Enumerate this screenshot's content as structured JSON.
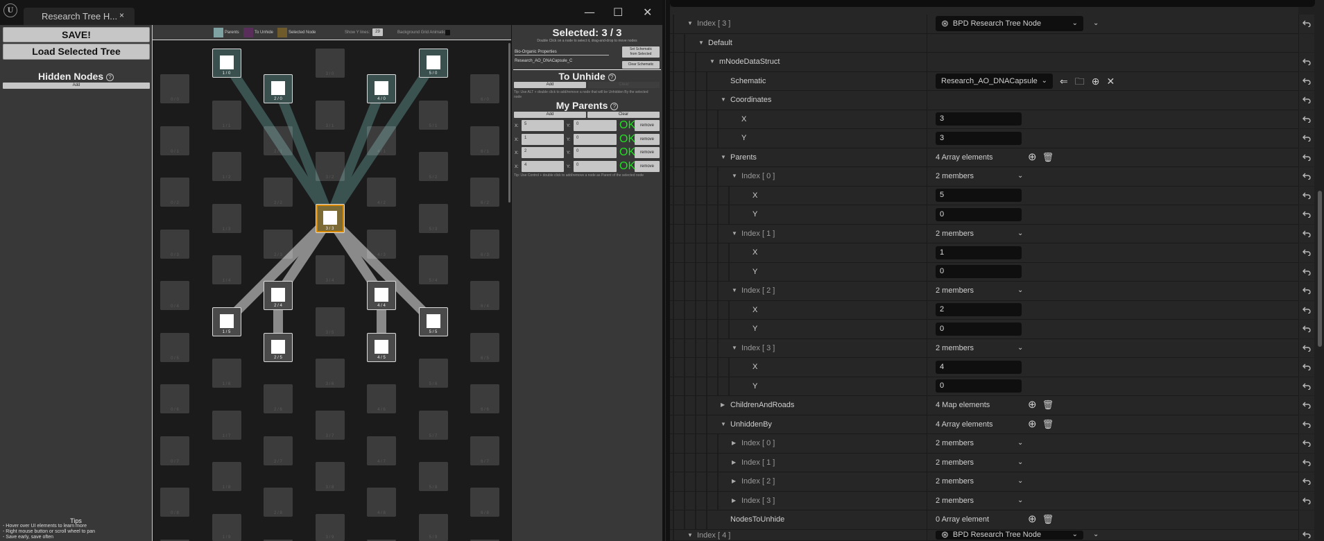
{
  "window": {
    "tab_title": "Research Tree H...",
    "close": "×",
    "minimize": "—",
    "maximize": "☐",
    "close_window": "✕",
    "logo": "U"
  },
  "left": {
    "save": "SAVE!",
    "load": "Load Selected Tree",
    "hidden_nodes_title": "Hidden Nodes",
    "help": "?",
    "add": "Add",
    "tips_title": "Tips",
    "tips": [
      "- Hover over UI elements to learn more",
      "- Right mouse button or scroll wheel to pan",
      "- Save early, save often"
    ]
  },
  "legend": {
    "parents": "Parents",
    "to_unhide": "To Unhide",
    "selected_node": "Selected Node",
    "show_y_lines_label": "Show Y lines:",
    "show_y_lines_value": "29",
    "bg_anim_label": "Background Grid Animation:"
  },
  "colors": {
    "parents": "#7fa3a3",
    "to_unhide": "#5a2e5a",
    "selected_node": "#6e5a2a",
    "parent_line": "#3a5250",
    "child_line": "#8a8a8a",
    "ok": "#22e022"
  },
  "graph": {
    "cols": 7,
    "rows": 10,
    "selected": [
      3,
      3
    ],
    "parents": [
      [
        1,
        0
      ],
      [
        2,
        0
      ],
      [
        4,
        0
      ],
      [
        5,
        0
      ]
    ],
    "children": [
      [
        2,
        4
      ],
      [
        4,
        4
      ],
      [
        1,
        5
      ],
      [
        5,
        5
      ],
      [
        2,
        5
      ],
      [
        4,
        5
      ]
    ],
    "parent_edges": [
      [
        [
          1,
          0
        ],
        [
          3,
          3
        ]
      ],
      [
        [
          2,
          0
        ],
        [
          3,
          3
        ]
      ],
      [
        [
          4,
          0
        ],
        [
          3,
          3
        ]
      ],
      [
        [
          5,
          0
        ],
        [
          3,
          3
        ]
      ]
    ],
    "child_edges": [
      [
        [
          3,
          3
        ],
        [
          2,
          4
        ]
      ],
      [
        [
          3,
          3
        ],
        [
          4,
          4
        ]
      ],
      [
        [
          3,
          3
        ],
        [
          1,
          5
        ]
      ],
      [
        [
          3,
          3
        ],
        [
          5,
          5
        ]
      ],
      [
        [
          2,
          4
        ],
        [
          2,
          5
        ]
      ],
      [
        [
          4,
          4
        ],
        [
          4,
          5
        ]
      ]
    ]
  },
  "selection": {
    "title": "Selected: 3 / 3",
    "hint": "Double Click on a node to select it, drag-and-drop to move nodes",
    "schematic_category": "Bio-Organic Properties",
    "schematic_name": "Research_AO_DNACapsule_C",
    "set_btn": "Set Schematic\nfrom Selected",
    "clear_btn": "Clear Schematic",
    "to_unhide_title": "To Unhide",
    "add": "Add",
    "clear": "Clear",
    "tip_unhide": "Tip: Use ALT + double click to add/remove a node that will be Unhidden By the selected node",
    "my_parents_title": "My Parents",
    "x_label": "X:",
    "y_label": "Y:",
    "parents": [
      {
        "x": "5",
        "y": "0",
        "status": "OK",
        "remove": "remove"
      },
      {
        "x": "1",
        "y": "0",
        "status": "OK",
        "remove": "remove"
      },
      {
        "x": "2",
        "y": "0",
        "status": "OK",
        "remove": "remove"
      },
      {
        "x": "4",
        "y": "0",
        "status": "OK",
        "remove": "remove"
      }
    ],
    "tip_parents": "Tip: Use Control + double click to add/remove a node as Parent of the selected node"
  },
  "details": {
    "rows": [
      {
        "label": "Index [ 3 ]",
        "depth": 0,
        "arrow": "down",
        "dim": true,
        "value": {
          "type": "class",
          "text": "BPD Research Tree Node"
        }
      },
      {
        "label": "Default",
        "depth": 1,
        "arrow": "down",
        "value": {
          "type": "none"
        },
        "noreset": true
      },
      {
        "label": "mNodeDataStruct",
        "depth": 2,
        "arrow": "down",
        "value": {
          "type": "none"
        }
      },
      {
        "label": "Schematic",
        "depth": 3,
        "value": {
          "type": "object",
          "text": "Research_AO_DNACapsule"
        }
      },
      {
        "label": "Coordinates",
        "depth": 3,
        "arrow": "down",
        "value": {
          "type": "none"
        }
      },
      {
        "label": "X",
        "depth": 4,
        "value": {
          "type": "num",
          "text": "3"
        }
      },
      {
        "label": "Y",
        "depth": 4,
        "value": {
          "type": "num",
          "text": "3"
        }
      },
      {
        "label": "Parents",
        "depth": 3,
        "arrow": "down",
        "value": {
          "type": "array",
          "text": "4 Array elements"
        }
      },
      {
        "label": "Index [ 0 ]",
        "depth": 4,
        "arrow": "down",
        "dim": true,
        "value": {
          "type": "members",
          "text": "2 members"
        }
      },
      {
        "label": "X",
        "depth": 5,
        "value": {
          "type": "num",
          "text": "5"
        }
      },
      {
        "label": "Y",
        "depth": 5,
        "value": {
          "type": "num",
          "text": "0"
        }
      },
      {
        "label": "Index [ 1 ]",
        "depth": 4,
        "arrow": "down",
        "dim": true,
        "value": {
          "type": "members",
          "text": "2 members"
        }
      },
      {
        "label": "X",
        "depth": 5,
        "value": {
          "type": "num",
          "text": "1"
        }
      },
      {
        "label": "Y",
        "depth": 5,
        "value": {
          "type": "num",
          "text": "0"
        }
      },
      {
        "label": "Index [ 2 ]",
        "depth": 4,
        "arrow": "down",
        "dim": true,
        "value": {
          "type": "members",
          "text": "2 members"
        }
      },
      {
        "label": "X",
        "depth": 5,
        "value": {
          "type": "num",
          "text": "2"
        }
      },
      {
        "label": "Y",
        "depth": 5,
        "value": {
          "type": "num",
          "text": "0"
        }
      },
      {
        "label": "Index [ 3 ]",
        "depth": 4,
        "arrow": "down",
        "dim": true,
        "value": {
          "type": "members",
          "text": "2 members"
        }
      },
      {
        "label": "X",
        "depth": 5,
        "value": {
          "type": "num",
          "text": "4"
        }
      },
      {
        "label": "Y",
        "depth": 5,
        "value": {
          "type": "num",
          "text": "0"
        }
      },
      {
        "label": "ChildrenAndRoads",
        "depth": 3,
        "arrow": "right",
        "value": {
          "type": "array",
          "text": "4 Map elements"
        }
      },
      {
        "label": "UnhiddenBy",
        "depth": 3,
        "arrow": "down",
        "value": {
          "type": "array",
          "text": "4 Array elements"
        }
      },
      {
        "label": "Index [ 0 ]",
        "depth": 4,
        "arrow": "right",
        "dim": true,
        "value": {
          "type": "members",
          "text": "2 members"
        }
      },
      {
        "label": "Index [ 1 ]",
        "depth": 4,
        "arrow": "right",
        "dim": true,
        "value": {
          "type": "members",
          "text": "2 members"
        }
      },
      {
        "label": "Index [ 2 ]",
        "depth": 4,
        "arrow": "right",
        "dim": true,
        "value": {
          "type": "members",
          "text": "2 members"
        }
      },
      {
        "label": "Index [ 3 ]",
        "depth": 4,
        "arrow": "right",
        "dim": true,
        "value": {
          "type": "members",
          "text": "2 members"
        }
      },
      {
        "label": "NodesToUnhide",
        "depth": 3,
        "value": {
          "type": "array",
          "text": "0 Array element"
        },
        "noreset": true
      },
      {
        "label": "Index [ 4 ]",
        "depth": 0,
        "arrow": "down",
        "dim": true,
        "value": {
          "type": "class",
          "text": "BPD Research Tree Node"
        }
      }
    ]
  }
}
